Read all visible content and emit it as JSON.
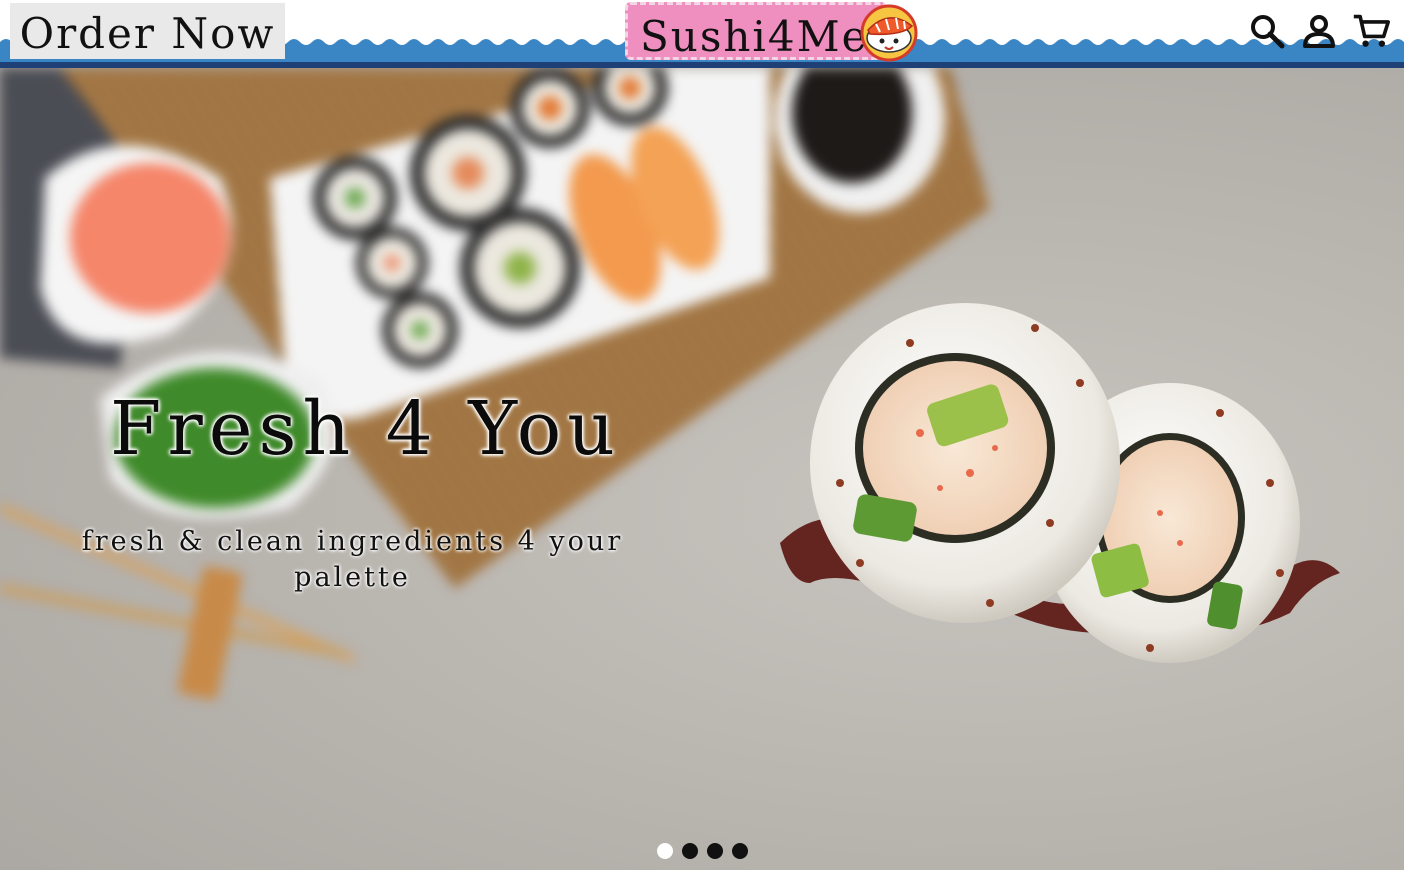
{
  "header": {
    "order_now_label": "Order Now",
    "logo_text": "Sushi4Me",
    "icons": [
      "search-icon",
      "account-icon",
      "cart-icon"
    ]
  },
  "hero": {
    "title": "Fresh 4 You",
    "subtitle": "fresh & clean ingredients 4 your palette",
    "slide_count": 4,
    "active_slide": 1
  },
  "colors": {
    "header_bar": "#1f3f77",
    "wave": "#3a85c4",
    "logo_bg": "#ef8fc0",
    "order_bg": "#e9e9e9"
  }
}
